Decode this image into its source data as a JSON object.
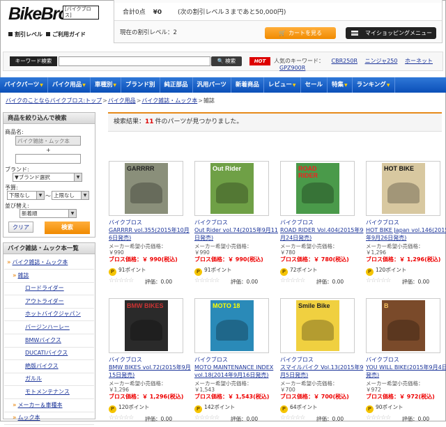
{
  "header": {
    "logo_text": "BikeBros.",
    "logo_tag": "[バイクブロス]",
    "link_discount": "割引レベル",
    "link_guide": "ご利用ガイド",
    "cart_total_label": "合計0点",
    "cart_total_price": "¥0",
    "cart_next_level": "(次の割引レベル３まであと50,000円)",
    "current_level": "現在の割引レベル：2",
    "cart_button": "カートを見る",
    "menu_button": "マイショッピングメニュー"
  },
  "search": {
    "label": "キーワード検索",
    "button": "検索",
    "hot_badge": "HOT",
    "popular_label": "人気のキーワード：",
    "popular": [
      "CBR250R",
      "ニンジャ250",
      "ホーネット",
      "GPZ900R"
    ]
  },
  "nav": [
    {
      "label": "バイクパーツ",
      "arrow": true
    },
    {
      "label": "バイク用品",
      "arrow": true
    },
    {
      "label": "車種別",
      "arrow": true
    },
    {
      "label": "ブランド別",
      "arrow": false
    },
    {
      "label": "純正部品",
      "arrow": false
    },
    {
      "label": "汎用パーツ",
      "arrow": false
    },
    {
      "label": "新着商品",
      "arrow": false
    },
    {
      "label": "レビュー",
      "arrow": true
    },
    {
      "label": "セール",
      "arrow": false
    },
    {
      "label": "特集",
      "arrow": true
    },
    {
      "label": "ランキング",
      "arrow": true
    }
  ],
  "breadcrumb": [
    "バイクのことならバイクブロス:トップ",
    "バイク用品",
    "バイク雑誌・ムック本",
    "雑誌"
  ],
  "filter": {
    "title": "商品を絞り込んで検索",
    "name_label": "商品名:",
    "name_value": "バイク雑誌・ムック本",
    "plus": "+",
    "brand_label": "ブランド:",
    "brand_value": "▼ブランド選択",
    "budget_label": "予算:",
    "min_value": "下限なし",
    "tilde": "〜",
    "max_value": "上限なし",
    "sort_label": "並び替え:",
    "sort_value": "新着順",
    "clear": "クリア",
    "search": "検索"
  },
  "category": {
    "title": "バイク雑誌・ムック本一覧",
    "items": [
      {
        "label": "バイク雑誌・ムック本",
        "indent": 0
      },
      {
        "label": "雑誌",
        "indent": 1
      },
      {
        "label": "ロードライダー",
        "indent": 2
      },
      {
        "label": "アウトライダー",
        "indent": 2
      },
      {
        "label": "ホットバイクジャパン",
        "indent": 2
      },
      {
        "label": "バージンハーレー",
        "indent": 2
      },
      {
        "label": "BMWバイクス",
        "indent": 2
      },
      {
        "label": "DUCATIバイクス",
        "indent": 2
      },
      {
        "label": "絶版バイクス",
        "indent": 2
      },
      {
        "label": "ガルル",
        "indent": 2
      },
      {
        "label": "モトメンテナンス",
        "indent": 2
      },
      {
        "label": "メーカー＆車種本",
        "indent": 1
      },
      {
        "label": "ムック本",
        "indent": 1
      }
    ]
  },
  "result": {
    "prefix": "検索結果：",
    "count": "11",
    "suffix": "件のパーツが見つかりました。"
  },
  "products": [
    {
      "category": "バイクブロス",
      "title": "GARRRR vol.355(2015年10月6日発売)",
      "maker_label": "メーカー希望小売価格：",
      "maker_price": "￥990",
      "price": "ブロス価格：￥ 990(税込)",
      "points": "91ポイント",
      "rating": "評価：0.00",
      "cover_bg": "#8a8f7a",
      "cover_fg": "#222",
      "cover_text": "GARRRR"
    },
    {
      "category": "バイクブロス",
      "title": "Out Rider vol.74(2015年9月11日発売)",
      "maker_label": "メーカー希望小売価格：",
      "maker_price": "￥990",
      "price": "ブロス価格：￥ 990(税込)",
      "points": "91ポイント",
      "rating": "評価：0.00",
      "cover_bg": "#6fa046",
      "cover_fg": "#fff",
      "cover_text": "Out Rider"
    },
    {
      "category": "バイクブロス",
      "title": "ROAD RIDER Vol.404(2015年9月24日発売)",
      "maker_label": "メーカー希望小売価格：",
      "maker_price": "￥780",
      "price": "ブロス価格：￥ 780(税込)",
      "points": "72ポイント",
      "rating": "評価：0.00",
      "cover_bg": "#4a9a4a",
      "cover_fg": "#e22",
      "cover_text": "ROAD RIDER"
    },
    {
      "category": "バイクブロス",
      "title": "HOT BIKE Japan vol.146(2015年9月26日発売)",
      "maker_label": "メーカー希望小売価格：",
      "maker_price": "￥1,296",
      "price": "ブロス価格：￥ 1,296(税込)",
      "points": "120ポイント",
      "rating": "評価：0.00",
      "cover_bg": "#d8c8a0",
      "cover_fg": "#111",
      "cover_text": "HOT BIKE"
    },
    {
      "category": "バイクブロス",
      "title": "BMW BIKES vol.72(2015年9月15日発売)",
      "maker_label": "メーカー希望小売価格：",
      "maker_price": "￥1,296",
      "price": "ブロス価格：￥ 1,296(税込)",
      "points": "120ポイント",
      "rating": "評価：0.00",
      "cover_bg": "#2a2a2a",
      "cover_fg": "#c33",
      "cover_text": "BMW BIKES"
    },
    {
      "category": "バイクブロス",
      "title": "MOTO MAINTENANCE INDEX vol.18(2014年9月16日発売)",
      "maker_label": "メーカー希望小売価格：",
      "maker_price": "￥1,543",
      "price": "ブロス価格：￥ 1,543(税込)",
      "points": "142ポイント",
      "rating": "評価：0.00",
      "cover_bg": "#2a8ab8",
      "cover_fg": "#ff0",
      "cover_text": "MOTO 18"
    },
    {
      "category": "バイクブロス",
      "title": "スマイルバイク Vol.13(2015年9月5日発売)",
      "maker_label": "メーカー希望小売価格：",
      "maker_price": "￥700",
      "price": "ブロス価格：￥ 700(税込)",
      "points": "64ポイント",
      "rating": "評価：0.00",
      "cover_bg": "#f0d040",
      "cover_fg": "#222",
      "cover_text": "Smile Bike"
    },
    {
      "category": "バイクブロス",
      "title": "YOU WILL BIKE(2015年9月4日発売)",
      "maker_label": "メーカー希望小売価格：",
      "maker_price": "￥972",
      "price": "ブロス価格：￥ 972(税込)",
      "points": "90ポイント",
      "rating": "評価：0.00",
      "cover_bg": "#7a4a2a",
      "cover_fg": "#f5c060",
      "cover_text": "B"
    }
  ],
  "stars": "☆☆☆☆☆",
  "coin_char": "P",
  "colors": {
    "nav": "#1560c8",
    "accent": "#f08a00",
    "price": "#e00000",
    "hot": "#dd0000"
  }
}
